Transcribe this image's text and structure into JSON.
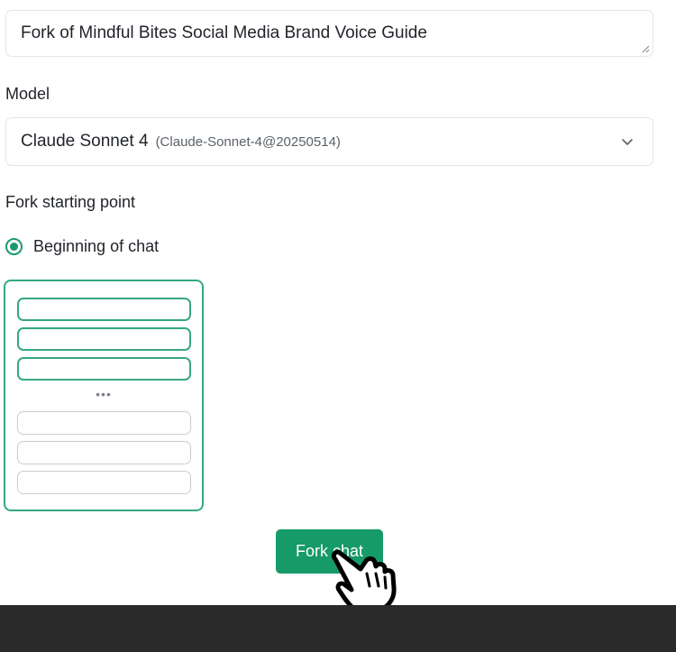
{
  "title_field": {
    "value": "Fork of Mindful Bites Social Media Brand Voice Guide"
  },
  "model": {
    "label": "Model",
    "selected_name": "Claude Sonnet 4",
    "selected_id": "(Claude-Sonnet-4@20250514)"
  },
  "fork_start": {
    "label": "Fork starting point",
    "option_label": "Beginning of chat",
    "preview_ellipsis": "•••"
  },
  "actions": {
    "fork_label": "Fork chat"
  },
  "colors": {
    "accent": "#159a68",
    "footer": "#2a2a2a"
  },
  "icons": {
    "resize": "resize-grip-icon",
    "select": "chevron-down-icon",
    "cursor": "hand-pointer-icon"
  }
}
